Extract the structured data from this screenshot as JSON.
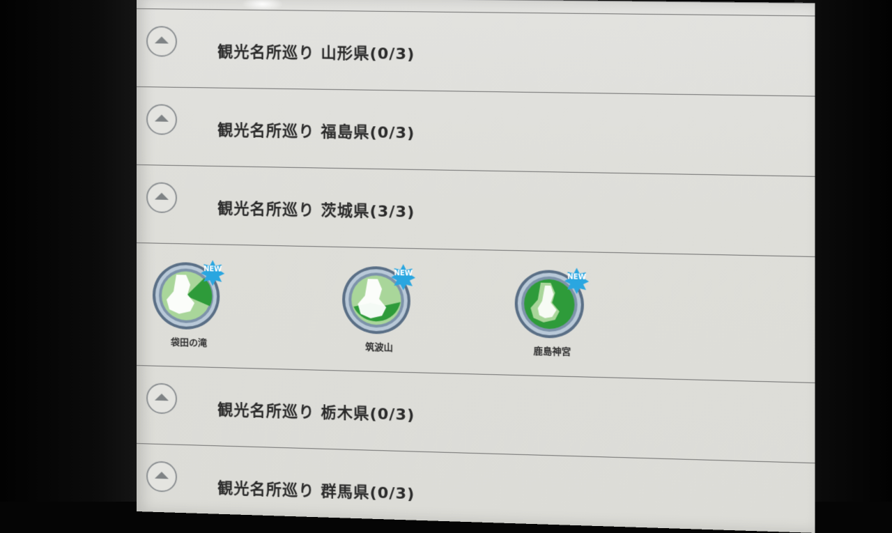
{
  "list": {
    "rows": [
      {
        "title": "観光名所巡り 山形県(0/3)"
      },
      {
        "title": "観光名所巡り 福島県(0/3)"
      },
      {
        "title": "観光名所巡り 茨城県(3/3)"
      },
      {
        "title": "観光名所巡り 栃木県(0/3)"
      },
      {
        "title": "観光名所巡り 群馬県(0/3)"
      }
    ],
    "badges": [
      {
        "label": "袋田の滝",
        "new_label": "NEW",
        "icon": "ibaraki-badge-icon"
      },
      {
        "label": "筑波山",
        "new_label": "NEW",
        "icon": "ibaraki-badge-icon"
      },
      {
        "label": "鹿島神宮",
        "new_label": "NEW",
        "icon": "ibaraki-badge-icon"
      }
    ]
  },
  "colors": {
    "badge_green": "#2e9b3a",
    "badge_light_green": "#a9d69a",
    "new_star": "#2aa6e0"
  }
}
